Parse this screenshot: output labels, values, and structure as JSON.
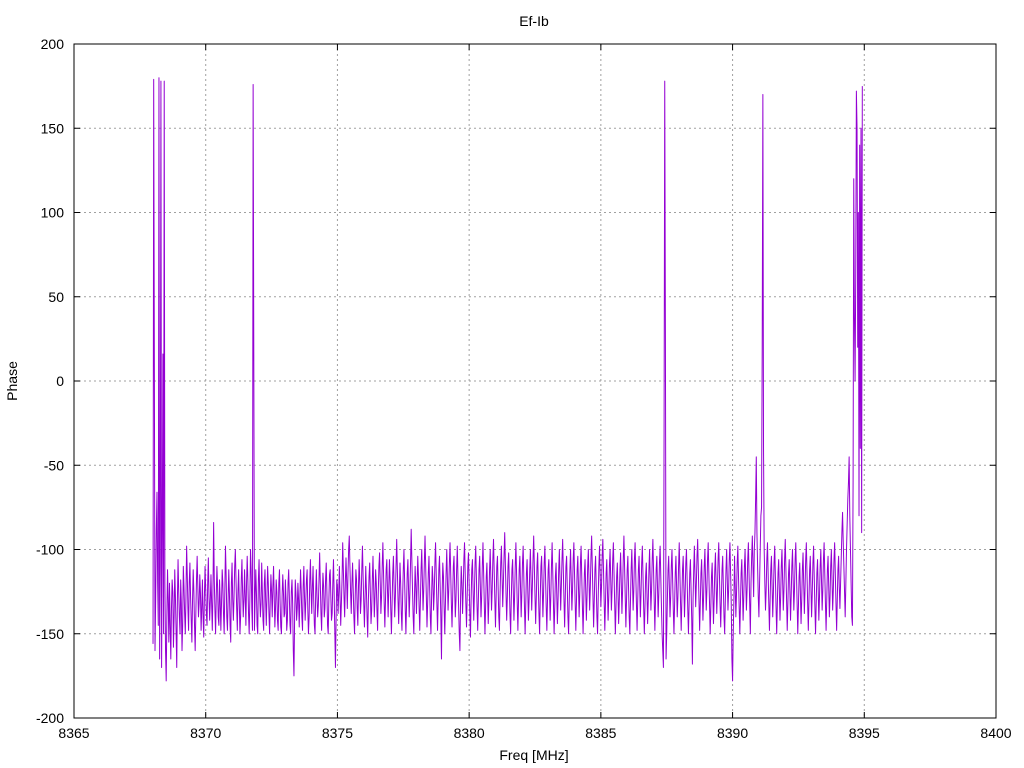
{
  "chart_data": {
    "type": "line",
    "title": "Ef-Ib",
    "xlabel": "Freq [MHz]",
    "ylabel": "Phase",
    "xlim": [
      8365,
      8400
    ],
    "ylim": [
      -200,
      200
    ],
    "xticks": [
      8365,
      8370,
      8375,
      8380,
      8385,
      8390,
      8395,
      8400
    ],
    "yticks": [
      -200,
      -150,
      -100,
      -50,
      0,
      50,
      100,
      150,
      200
    ],
    "grid": true,
    "legend": "none",
    "series": [
      {
        "color": "#9400d3",
        "x_start": 8368.0,
        "x_step": 0.025,
        "values": [
          -156,
          179,
          12,
          -160,
          -130,
          -88,
          -66,
          -120,
          -145,
          180,
          -165,
          -110,
          178,
          -170,
          -100,
          16,
          -150,
          178,
          -120,
          -160,
          -178,
          -140,
          -112,
          -130,
          -155,
          -120,
          -145,
          -165,
          -135,
          -118,
          -125,
          -158,
          -140,
          -112,
          -128,
          -148,
          -170,
          -130,
          -106,
          -125,
          -140,
          -150,
          -118,
          -132,
          -160,
          -145,
          -110,
          -122,
          -138,
          -150,
          -128,
          -98,
          -115,
          -135,
          -148,
          -120,
          -108,
          -128,
          -142,
          -155,
          -130,
          -112,
          -125,
          -145,
          -160,
          -138,
          -118,
          -104,
          -122,
          -140,
          -132,
          -115,
          -126,
          -148,
          -135,
          -118,
          -140,
          -152,
          -128,
          -110,
          -124,
          -138,
          -145,
          -120,
          -105,
          -128,
          -142,
          -130,
          -115,
          -132,
          -148,
          -125,
          -84,
          -118,
          -136,
          -150,
          -128,
          -110,
          -122,
          -140,
          -145,
          -118,
          -130,
          -148,
          -132,
          -112,
          -120,
          -138,
          -150,
          -125,
          -98,
          -115,
          -140,
          -148,
          -130,
          -112,
          -126,
          -145,
          -155,
          -120,
          -108,
          -130,
          -142,
          -128,
          -110,
          -100,
          -118,
          -135,
          -148,
          -125,
          -112,
          -132,
          -150,
          -140,
          -118,
          -106,
          -125,
          -140,
          -130,
          -112,
          -128,
          -145,
          -120,
          -104,
          -118,
          -138,
          -150,
          -130,
          -100,
          -112,
          -135,
          -148,
          176,
          16,
          -148,
          -130,
          -112,
          -125,
          -145,
          -150,
          -118,
          -106,
          -128,
          -140,
          -132,
          -108,
          -125,
          -142,
          -148,
          -120,
          -112,
          -130,
          -145,
          -128,
          -110,
          -120,
          -138,
          -150,
          -130,
          -115,
          -125,
          -140,
          -122,
          -110,
          -128,
          -146,
          -135,
          -118,
          -125,
          -142,
          -148,
          -120,
          -112,
          -132,
          -146,
          -150,
          -128,
          -115,
          -125,
          -140,
          -138,
          -118,
          -130,
          -148,
          -142,
          -120,
          -112,
          -128,
          -145,
          -150,
          -125,
          -118,
          -132,
          -160,
          -175,
          -140,
          -118,
          -126,
          -142,
          -135,
          -120,
          -130,
          -146,
          -128,
          -112,
          -124,
          -140,
          -148,
          -122,
          -110,
          -128,
          -142,
          -130,
          -118,
          -112,
          -135,
          -150,
          -140,
          -118,
          -106,
          -125,
          -138,
          -122,
          -110,
          -130,
          -145,
          -150,
          -126,
          -112,
          -128,
          -140,
          -133,
          -118,
          -102,
          -120,
          -138,
          -148,
          -128,
          -114,
          -122,
          -140,
          -135,
          -118,
          -108,
          -125,
          -145,
          -150,
          -130,
          -115,
          -112,
          -128,
          -142,
          -138,
          -120,
          -106,
          -126,
          -148,
          -170,
          -140,
          -118,
          -122,
          -138,
          -125,
          -110,
          -128,
          -145,
          -132,
          -118,
          -96,
          -112,
          -128,
          -140,
          -120,
          -105,
          -118,
          -135,
          -115,
          -100,
          -92,
          -110,
          -126,
          -138,
          -120,
          -108,
          -124,
          -140,
          -150,
          -128,
          -112,
          -118,
          -135,
          -145,
          -122,
          -106,
          -120,
          -138,
          -130,
          -112,
          -98,
          -116,
          -132,
          -146,
          -128,
          -110,
          -124,
          -140,
          -152,
          -130,
          -116,
          -108,
          -126,
          -144,
          -136,
          -118,
          -104,
          -122,
          -140,
          -128,
          -112,
          -120,
          -136,
          -148,
          -126,
          -110,
          -102,
          -120,
          -138,
          -128,
          -110,
          -96,
          -114,
          -132,
          -146,
          -130,
          -112,
          -106,
          -124,
          -140,
          -122,
          -106,
          -118,
          -136,
          -150,
          -132,
          -114,
          -104,
          -122,
          -140,
          -128,
          -110,
          -94,
          -112,
          -130,
          -144,
          -126,
          -108,
          -120,
          -138,
          -148,
          -128,
          -112,
          -100,
          -118,
          -136,
          -150,
          -132,
          -114,
          -106,
          -124,
          -140,
          -126,
          -108,
          -88,
          -106,
          -124,
          -140,
          -150,
          -128,
          -110,
          -122,
          -138,
          -120,
          -104,
          -116,
          -134,
          -148,
          -130,
          -112,
          -100,
          -118,
          -136,
          -124,
          -108,
          -92,
          -110,
          -128,
          -146,
          -132,
          -114,
          -104,
          -122,
          -140,
          -150,
          -128,
          -110,
          -118,
          -136,
          -126,
          -108,
          -96,
          -114,
          -132,
          -148,
          -130,
          -112,
          -104,
          -122,
          -140,
          -165,
          -126,
          -108,
          -116,
          -134,
          -150,
          -132,
          -114,
          -100,
          -118,
          -136,
          -124,
          -108,
          -96,
          -114,
          -132,
          -146,
          -128,
          -110,
          -104,
          -122,
          -140,
          -130,
          -112,
          -98,
          -116,
          -134,
          -150,
          -160,
          -128,
          -110,
          -120,
          -138,
          -124,
          -106,
          -96,
          -114,
          -132,
          -146,
          -128,
          -110,
          -102,
          -120,
          -138,
          -152,
          -130,
          -112,
          -106,
          -124,
          -142,
          -126,
          -108,
          -98,
          -116,
          -134,
          -148,
          -130,
          -112,
          -104,
          -122,
          -140,
          -128,
          -110,
          -96,
          -114,
          -132,
          -150,
          -134,
          -116,
          -108,
          -126,
          -144,
          -130,
          -112,
          -100,
          -118,
          -136,
          -124,
          -106,
          -94,
          -112,
          -130,
          -146,
          -128,
          -110,
          -104,
          -122,
          -140,
          -148,
          -126,
          -108,
          -98,
          -116,
          -134,
          -120,
          -104,
          -90,
          -108,
          -126,
          -142,
          -128,
          -110,
          -102,
          -120,
          -138,
          -150,
          -130,
          -112,
          -106,
          -124,
          -142,
          -128,
          -110,
          -96,
          -114,
          -132,
          -148,
          -130,
          -112,
          -104,
          -122,
          -140,
          -126,
          -108,
          -98,
          -116,
          -134,
          -150,
          -132,
          -114,
          -106,
          -124,
          -142,
          -130,
          -112,
          -100,
          -118,
          -136,
          -122,
          -106,
          -92,
          -110,
          -128,
          -144,
          -128,
          -110,
          -102,
          -120,
          -138,
          -150,
          -128,
          -110,
          -104,
          -122,
          -140,
          -126,
          -108,
          -98,
          -116,
          -134,
          -148,
          -130,
          -112,
          -106,
          -124,
          -142,
          -128,
          -110,
          -96,
          -114,
          -132,
          -150,
          -134,
          -116,
          -108,
          -126,
          -144,
          -130,
          -112,
          -100,
          -118,
          -136,
          -122,
          -106,
          -94,
          -112,
          -130,
          -146,
          -128,
          -110,
          -104,
          -122,
          -140,
          -150,
          -130,
          -112,
          -100,
          -118,
          -136,
          -124,
          -106,
          -96,
          -114,
          -132,
          -148,
          -130,
          -112,
          -104,
          -122,
          -140,
          -126,
          -108,
          -98,
          -116,
          -134,
          -150,
          -132,
          -114,
          -106,
          -124,
          -142,
          -128,
          -110,
          -100,
          -118,
          -136,
          -122,
          -104,
          -92,
          -110,
          -128,
          -146,
          -130,
          -112,
          -104,
          -122,
          -140,
          -150,
          -128,
          -110,
          -98,
          -116,
          -134,
          -122,
          -104,
          -94,
          -112,
          -130,
          -148,
          -132,
          -114,
          -106,
          -124,
          -142,
          -128,
          -110,
          -100,
          -118,
          -136,
          -124,
          -106,
          -96,
          -114,
          -132,
          -150,
          -134,
          -116,
          -108,
          -126,
          -144,
          -130,
          -112,
          -102,
          -120,
          -138,
          -124,
          -106,
          -92,
          -110,
          -128,
          -146,
          -130,
          -112,
          -104,
          -122,
          -140,
          -150,
          -130,
          -112,
          -100,
          -118,
          -136,
          -124,
          -106,
          -96,
          -114,
          -132,
          -148,
          -130,
          -112,
          -104,
          -122,
          -140,
          -126,
          -108,
          -98,
          -116,
          -134,
          -150,
          -134,
          -116,
          -108,
          -126,
          -144,
          -130,
          -112,
          -100,
          -118,
          -136,
          -124,
          -106,
          -94,
          -112,
          -130,
          -148,
          -130,
          -112,
          -104,
          -122,
          -140,
          -126,
          -108,
          -98,
          -116,
          -134,
          -150,
          -160,
          -170,
          -30,
          178,
          30,
          -165,
          -150,
          -130,
          -112,
          -104,
          -122,
          -140,
          -128,
          -110,
          -100,
          -118,
          -136,
          -150,
          -132,
          -114,
          -104,
          -122,
          -140,
          -128,
          -110,
          -96,
          -114,
          -132,
          -148,
          -130,
          -112,
          -104,
          -122,
          -140,
          -126,
          -108,
          -100,
          -118,
          -136,
          -150,
          -132,
          -114,
          -106,
          -124,
          -142,
          -168,
          -130,
          -112,
          -98,
          -116,
          -134,
          -120,
          -104,
          -94,
          -112,
          -130,
          -148,
          -132,
          -114,
          -106,
          -124,
          -142,
          -128,
          -110,
          -100,
          -118,
          -136,
          -124,
          -106,
          -96,
          -114,
          -132,
          -150,
          -134,
          -116,
          -108,
          -126,
          -144,
          -130,
          -112,
          -102,
          -120,
          -138,
          -124,
          -106,
          -96,
          -114,
          -132,
          -146,
          -130,
          -112,
          -104,
          -122,
          -140,
          -150,
          -130,
          -112,
          -100,
          -118,
          -136,
          -124,
          -106,
          -96,
          -114,
          -132,
          -165,
          -178,
          -150,
          -130,
          -104,
          -122,
          -140,
          -126,
          -108,
          -98,
          -116,
          -134,
          -150,
          -132,
          -114,
          -106,
          -124,
          -142,
          -128,
          -110,
          -100,
          -118,
          -136,
          -124,
          -106,
          -96,
          -114,
          -132,
          -150,
          -120,
          -104,
          -92,
          -110,
          -128,
          -100,
          -90,
          -70,
          -45,
          -90,
          -110,
          -128,
          -140,
          -120,
          -100,
          -80,
          -75,
          20,
          170,
          -40,
          -100,
          -120,
          -136,
          -124,
          -106,
          -96,
          -114,
          -132,
          -148,
          -130,
          -112,
          -104,
          -122,
          -140,
          -126,
          -108,
          -98,
          -116,
          -134,
          -150,
          -132,
          -114,
          -106,
          -124,
          -142,
          -128,
          -110,
          -100,
          -118,
          -136,
          -124,
          -106,
          -94,
          -112,
          -130,
          -148,
          -132,
          -114,
          -106,
          -124,
          -142,
          -128,
          -110,
          -100,
          -118,
          -136,
          -124,
          -106,
          -96,
          -114,
          -132,
          -150,
          -134,
          -116,
          -108,
          -126,
          -144,
          -130,
          -112,
          -102,
          -120,
          -138,
          -124,
          -106,
          -96,
          -114,
          -132,
          -148,
          -130,
          -112,
          -104,
          -122,
          -140,
          -126,
          -108,
          -98,
          -116,
          -134,
          -150,
          -132,
          -114,
          -106,
          -124,
          -142,
          -128,
          -110,
          -100,
          -118,
          -136,
          -124,
          -106,
          -96,
          -114,
          -132,
          -148,
          -130,
          -112,
          -104,
          -122,
          -140,
          -128,
          -110,
          -100,
          -118,
          -136,
          -124,
          -106,
          -96,
          -114,
          -132,
          -148,
          -130,
          -112,
          -104,
          -122,
          -135,
          -120,
          -105,
          -90,
          -78,
          -95,
          -110,
          -125,
          -140,
          -120,
          -100,
          -85,
          -70,
          -60,
          -45,
          -80,
          -100,
          -120,
          -140,
          -145,
          -60,
          120,
          40,
          0,
          60,
          172,
          150,
          20,
          100,
          -80,
          140,
          -40,
          150,
          -90,
          175
        ]
      }
    ]
  }
}
